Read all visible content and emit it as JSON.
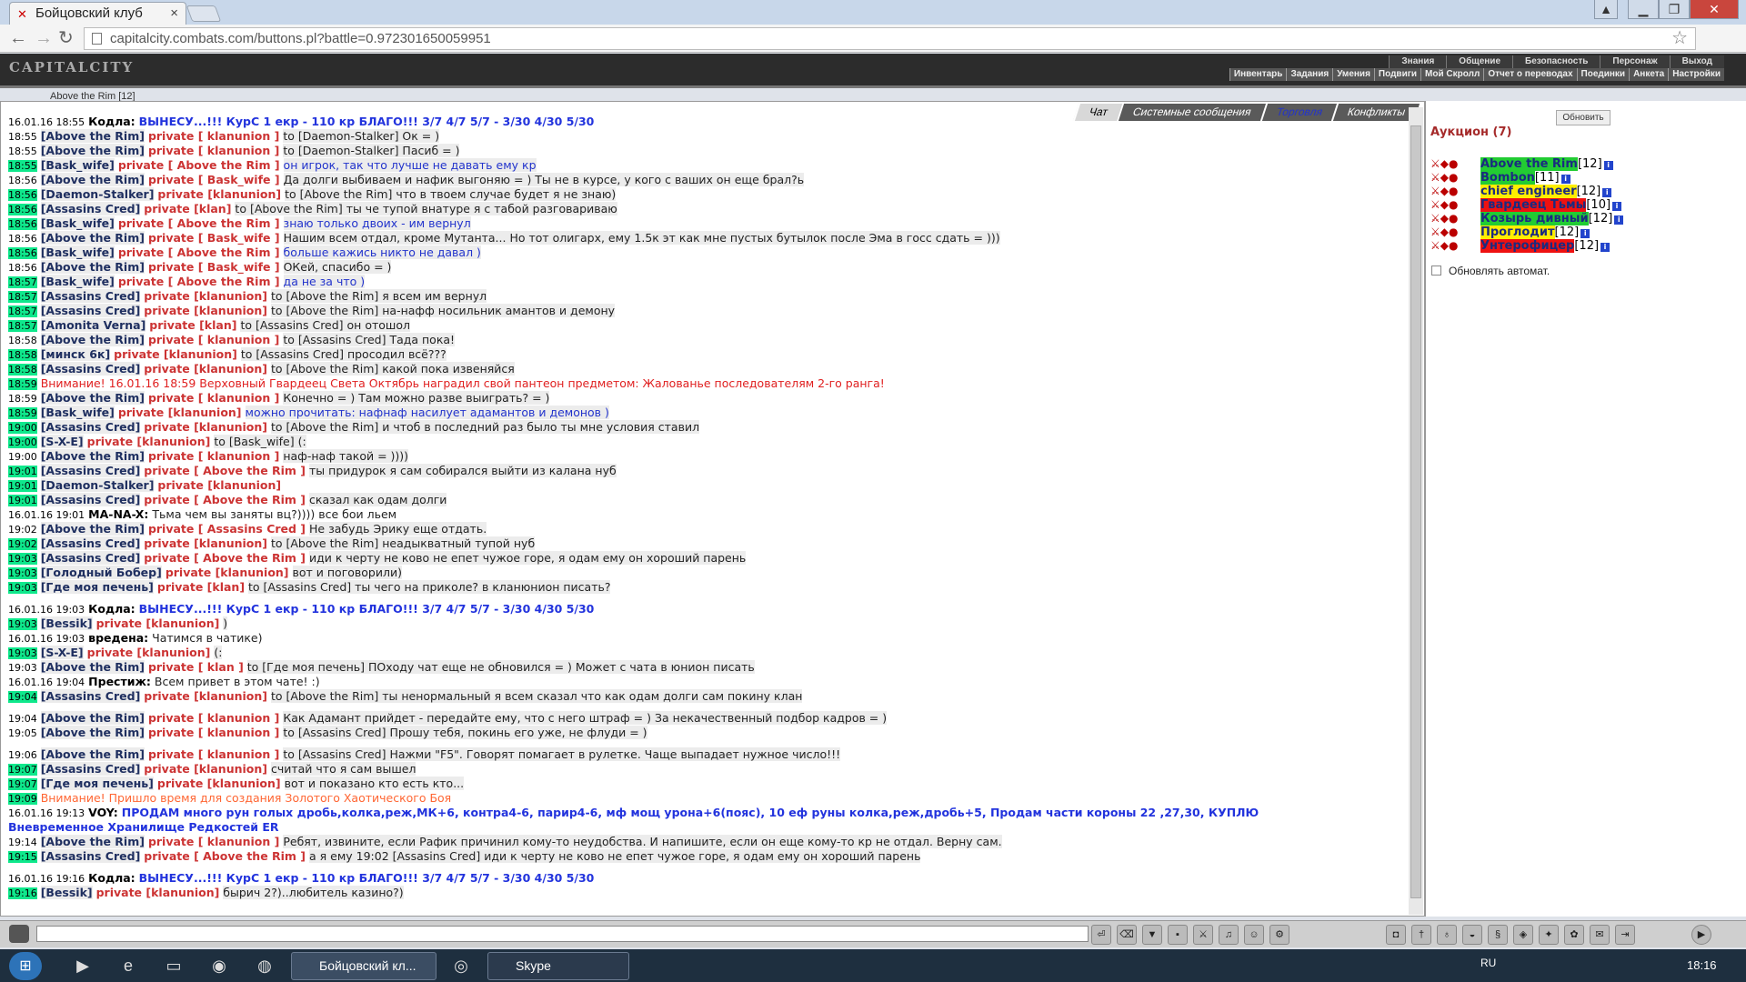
{
  "browser": {
    "tab_title": "Бойцовский клуб",
    "url": "capitalcity.combats.com/buttons.pl?battle=0.972301650059951"
  },
  "game": {
    "logo": "CAPITALCITY",
    "top_menu": [
      "Знания",
      "Общение",
      "Безопасность",
      "Персонаж",
      "Выход"
    ],
    "sub_menu": [
      "Инвентарь",
      "Задания",
      "Умения",
      "Подвиги",
      "Мой Скролл",
      "Отчет о переводах",
      "Поединки",
      "Анкета",
      "Настройки"
    ],
    "subtitle": "Above the Rim [12]"
  },
  "chat": {
    "tabs": [
      "Чат",
      "Системные сообщения",
      "Торговля",
      "Конфликты"
    ],
    "messages": [
      {
        "t": "16.01.16 18:55",
        "g": false,
        "kind": "banner",
        "who": "Кодла:",
        "text": "ВЫНЕСУ...!!! КурС 1 екр - 110 кр БЛАГО!!! 3/7 4/7 5/7 - 3/30 4/30 5/30"
      },
      {
        "t": "18:55",
        "g": false,
        "who": "[Above the Rim]",
        "pv": "private [ klanunion ]",
        "text": "to [Daemon-Stalker] Ок = )"
      },
      {
        "t": "18:55",
        "g": false,
        "who": "[Above the Rim]",
        "pv": "private [ klanunion ]",
        "text": "to [Daemon-Stalker] Пасиб = )"
      },
      {
        "t": "18:55",
        "g": true,
        "who": "[Bask_wife]",
        "pv": "private [ Above the Rim ]",
        "text": "он игрок, так что лучше не давать ему кр",
        "blue": true
      },
      {
        "t": "18:56",
        "g": false,
        "who": "[Above the Rim]",
        "pv": "private [ Bask_wife ]",
        "text": "Да долги выбиваем и нафик выгоняю = ) Ты не в курсе, у кого с ваших он еще брал?ь"
      },
      {
        "t": "18:56",
        "g": true,
        "who": "[Daemon-Stalker]",
        "pv": "private [klanunion]",
        "text": "to [Above the Rim] что в твоем случае будет я не знаю)"
      },
      {
        "t": "18:56",
        "g": true,
        "who": "[Assasins Cred]",
        "pv": "private [klan]",
        "text": "to [Above the Rim] ты че тупой внатуре я с табой разговариваю"
      },
      {
        "t": "18:56",
        "g": true,
        "who": "[Bask_wife]",
        "pv": "private [ Above the Rim ]",
        "text": "знаю только двоих - им вернул",
        "blue": true
      },
      {
        "t": "18:56",
        "g": false,
        "who": "[Above the Rim]",
        "pv": "private [ Bask_wife ]",
        "text": "Нашим всем отдал, кроме Мутанта... Но тот олигарх, ему 1.5к эт как мне пустых бутылок после Эма в госс сдать = )))"
      },
      {
        "t": "18:56",
        "g": true,
        "who": "[Bask_wife]",
        "pv": "private [ Above the Rim ]",
        "text": "больше кажись никто не давал )",
        "blue": true
      },
      {
        "t": "18:56",
        "g": false,
        "who": "[Above the Rim]",
        "pv": "private [ Bask_wife ]",
        "text": "ОКей, спасибо = )"
      },
      {
        "t": "18:57",
        "g": true,
        "who": "[Bask_wife]",
        "pv": "private [ Above the Rim ]",
        "text": "да не за что )",
        "blue": true
      },
      {
        "t": "18:57",
        "g": true,
        "who": "[Assasins Cred]",
        "pv": "private [klanunion]",
        "text": "to [Above the Rim] я всем им вернул"
      },
      {
        "t": "18:57",
        "g": true,
        "who": "[Assasins Cred]",
        "pv": "private [klanunion]",
        "text": "to [Above the Rim] на-нафф носильник амантов и демону"
      },
      {
        "t": "18:57",
        "g": true,
        "who": "[Amonita Verna]",
        "pv": "private [klan]",
        "text": "to [Assasins Cred] он отошол"
      },
      {
        "t": "18:58",
        "g": false,
        "who": "[Above the Rim]",
        "pv": "private [ klanunion ]",
        "text": "to [Assasins Cred] Тада пока!"
      },
      {
        "t": "18:58",
        "g": true,
        "who": "[минск 6к]",
        "pv": "private [klanunion]",
        "text": "to [Assasins Cred] просодил всё???"
      },
      {
        "t": "18:58",
        "g": true,
        "who": "[Assasins Cred]",
        "pv": "private [klanunion]",
        "text": "to [Above the Rim] какой пока извеняйся"
      },
      {
        "t": "18:59",
        "g": true,
        "kind": "warn",
        "text": "Внимание! 16.01.16 18:59 Верховный Гвардеец Света Октябрь наградил свой пантеон предметом: Жалованье последователям 2-го ранга!"
      },
      {
        "t": "18:59",
        "g": false,
        "who": "[Above the Rim]",
        "pv": "private [ klanunion ]",
        "text": "Конечно = ) Там можно разве выиграть? = )"
      },
      {
        "t": "18:59",
        "g": true,
        "who": "[Bask_wife]",
        "pv": "private [klanunion]",
        "text": "можно прочитать: нафнаф насилует адамантов и демонов )",
        "blue": true
      },
      {
        "t": "19:00",
        "g": true,
        "who": "[Assasins Cred]",
        "pv": "private [klanunion]",
        "text": "to [Above the Rim] и чтоб в последний раз было ты мне условия ставил"
      },
      {
        "t": "19:00",
        "g": true,
        "who": "[S-X-E]",
        "pv": "private [klanunion]",
        "text": "to [Bask_wife] (:"
      },
      {
        "t": "19:00",
        "g": false,
        "who": "[Above the Rim]",
        "pv": "private [ klanunion ]",
        "text": "наф-наф такой = ))))"
      },
      {
        "t": "19:01",
        "g": true,
        "who": "[Assasins Cred]",
        "pv": "private [ Above the Rim ]",
        "text": "ты придурок я сам собирался выйти из калана нуб"
      },
      {
        "t": "19:01",
        "g": true,
        "who": "[Daemon-Stalker]",
        "pv": "private [klanunion]",
        "text": ""
      },
      {
        "t": "19:01",
        "g": true,
        "who": "[Assasins Cred]",
        "pv": "private [ Above the Rim ]",
        "text": "сказал как одам долги"
      },
      {
        "t": "16.01.16 19:01",
        "g": false,
        "kind": "plain",
        "who": "MA-NA-X:",
        "text": "Тьма чем вы заняты вц?)))) все бои льем"
      },
      {
        "t": "19:02",
        "g": false,
        "who": "[Above the Rim]",
        "pv": "private [ Assasins Cred ]",
        "text": "Не забудь Эрику еще отдать."
      },
      {
        "t": "19:02",
        "g": true,
        "who": "[Assasins Cred]",
        "pv": "private [klanunion]",
        "text": "to [Above the Rim] неадыкватный тупой нуб"
      },
      {
        "t": "19:03",
        "g": true,
        "who": "[Assasins Cred]",
        "pv": "private [ Above the Rim ]",
        "text": "иди к черту не ково не епет чужое горе, я одам ему он хороший парень"
      },
      {
        "t": "19:03",
        "g": true,
        "who": "[Голодный Бобер]",
        "pv": "private [klanunion]",
        "text": "вот и поговорили)"
      },
      {
        "t": "19:03",
        "g": true,
        "who": "[Где моя печень]",
        "pv": "private [klan]",
        "text": "to [Assasins Cred] ты чего на приколе? в кланюнион писать?"
      },
      {
        "t": "16.01.16 19:03",
        "g": false,
        "kind": "banner",
        "gap": true,
        "who": "Кодла:",
        "text": "ВЫНЕСУ...!!! КурС 1 екр - 110 кр БЛАГО!!! 3/7 4/7 5/7 - 3/30 4/30 5/30"
      },
      {
        "t": "19:03",
        "g": true,
        "who": "[Bessik]",
        "pv": "private [klanunion]",
        "text": ")"
      },
      {
        "t": "16.01.16 19:03",
        "g": false,
        "kind": "plain",
        "who": "вредена:",
        "text": "Чатимся в чатике)"
      },
      {
        "t": "19:03",
        "g": true,
        "who": "[S-X-E]",
        "pv": "private [klanunion]",
        "text": "(:"
      },
      {
        "t": "19:03",
        "g": false,
        "who": "[Above the Rim]",
        "pv": "private [ klan ]",
        "text": "to [Где моя печень] ПОходу чат еще не обновился = ) Может с чата в юнион писать"
      },
      {
        "t": "16.01.16 19:04",
        "g": false,
        "kind": "plain",
        "who": "Престиж:",
        "text": "Всем привет в этом чате! :)"
      },
      {
        "t": "19:04",
        "g": true,
        "who": "[Assasins Cred]",
        "pv": "private [klanunion]",
        "text": "to [Above the Rim] ты ненормальный я всем сказал что как одам долги сам покину клан"
      },
      {
        "t": "19:04",
        "g": false,
        "gap": true,
        "who": "[Above the Rim]",
        "pv": "private [ klanunion ]",
        "text": "Как Адамант прийдет - передайте ему, что с него штраф = ) За некачественный подбор кадров = )"
      },
      {
        "t": "19:05",
        "g": false,
        "who": "[Above the Rim]",
        "pv": "private [ klanunion ]",
        "text": "to [Assasins Cred] Прошу тебя, покинь его уже, не флуди = )"
      },
      {
        "t": "19:06",
        "g": false,
        "gap": true,
        "who": "[Above the Rim]",
        "pv": "private [ klanunion ]",
        "text": "to [Assasins Cred] Нажми \"F5\". Говорят помагает в рулетке. Чаще выпадает нужное число!!!"
      },
      {
        "t": "19:07",
        "g": true,
        "who": "[Assasins Cred]",
        "pv": "private [klanunion]",
        "text": "считай что я сам вышел"
      },
      {
        "t": "19:07",
        "g": true,
        "who": "[Где моя печень]",
        "pv": "private [klanunion]",
        "text": "вот и показано кто есть кто..."
      },
      {
        "t": "19:09",
        "g": true,
        "kind": "warn2",
        "text": "Внимание! Пришло время для создания Золотого Хаотического Боя"
      },
      {
        "t": "16.01.16 19:13",
        "g": false,
        "kind": "banner",
        "who": "VOY:",
        "text": "ПРОДАМ много рун голых дробь,колка,реж,МК+6, контра4-6, парир4-6, мф мощ урона+6(пояс), 10 еф руны колка,реж,дробь+5, Продам части короны 22 ,27,30, КУПЛЮ"
      },
      {
        "t": "",
        "g": false,
        "kind": "banner",
        "who": "",
        "text": "Вневременное Хранилище Редкостей ER"
      },
      {
        "t": "19:14",
        "g": false,
        "who": "[Above the Rim]",
        "pv": "private [ klanunion ]",
        "text": "Ребят, извините, если Рафик причинил кому-то неудобства. И напишите, если он еще кому-то кр не отдал. Верну сам."
      },
      {
        "t": "19:15",
        "g": true,
        "who": "[Assasins Cred]",
        "pv": "private [ Above the Rim ]",
        "text": "а я ему 19:02 [Assasins Cred] иди к черту не ково не епет чужое горе, я одам ему он хороший парень"
      },
      {
        "t": "16.01.16 19:16",
        "g": false,
        "kind": "banner",
        "gap": true,
        "who": "Кодла:",
        "text": "ВЫНЕСУ...!!! КурС 1 екр - 110 кр БЛАГО!!! 3/7 4/7 5/7 - 3/30 4/30 5/30"
      },
      {
        "t": "19:16",
        "g": true,
        "who": "[Bessik]",
        "pv": "private [klanunion]",
        "text": "бырич 2?)..любитель казино?)"
      }
    ]
  },
  "auction": {
    "refresh_label": "Обновить",
    "title": "Аукцион (7)",
    "players": [
      {
        "name": "Above the Rim",
        "level": "[12]",
        "bg": "#22cc33",
        "fg": "#1a2b80"
      },
      {
        "name": "Bombon",
        "level": "[11]",
        "bg": "#22cc33",
        "fg": "#1a2b80"
      },
      {
        "name": "chief engineer",
        "level": "[12]",
        "bg": "#ffee00",
        "fg": "#1a2b80"
      },
      {
        "name": "Гвардеец Тьмы",
        "level": "[10]",
        "bg": "#ee1111",
        "fg": "#1a2b80"
      },
      {
        "name": "Козырь дивный",
        "level": "[12]",
        "bg": "#22cc33",
        "fg": "#1a2b80"
      },
      {
        "name": "Проглодит",
        "level": "[12]",
        "bg": "#ffee00",
        "fg": "#1a2b80"
      },
      {
        "name": "Унтерофицер",
        "level": "[12]",
        "bg": "#ee1111",
        "fg": "#1a2b80"
      }
    ],
    "auto_refresh_label": "Обновлять автомат."
  },
  "taskbar": {
    "tasks": [
      "Бойцовский кл...",
      "Skype"
    ],
    "lang": "RU",
    "clock": "18:16"
  }
}
